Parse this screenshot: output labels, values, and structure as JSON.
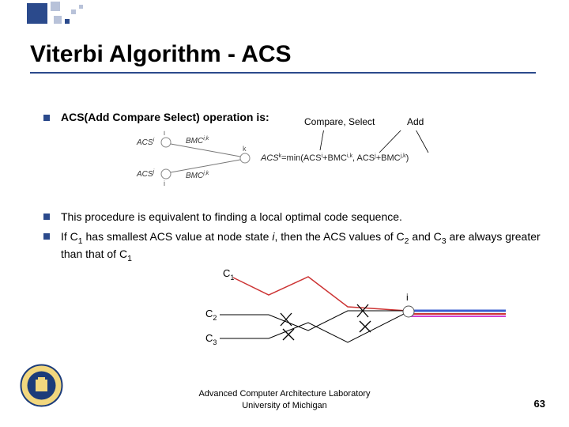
{
  "title": "Viterbi Algorithm - ACS",
  "bullets": {
    "b1": "ACS(Add Compare Select) operation is:",
    "b2": "This procedure is equivalent to finding a local optimal code sequence.",
    "b3_pre": "If C",
    "b3_s1": "1",
    "b3_mid1": " has smallest ACS value at node state ",
    "b3_i": "i",
    "b3_mid2": ", then the ACS values of C",
    "b3_s2": "2",
    "b3_mid3": " and C",
    "b3_s3": "3",
    "b3_mid4": " are always greater than that of C",
    "b3_s4": "1"
  },
  "labels": {
    "compare_select": "Compare, Select",
    "add": "Add"
  },
  "diagram1": {
    "acs_i": "ACS",
    "sup_i": "i",
    "bmc_ik": "BMC",
    "sup_ik": "i,k",
    "acs_j": "ACS",
    "sup_j": "j",
    "bmc_jk": "BMC",
    "sup_jk": "j,k",
    "node_i": "i",
    "node_j": "j",
    "node_k": "k",
    "eq_left": "ACS",
    "eq_sup": "k",
    "eq_eqmin": "=min(ACS",
    "eq_s1": "i",
    "eq_plus1": "+BMC",
    "eq_s2": "i,k",
    "eq_comma": ", ACS",
    "eq_s3": "j",
    "eq_plus2": "+BMC",
    "eq_s4": "j,k",
    "eq_close": ")"
  },
  "diagram2": {
    "c1": "C",
    "c1s": "1",
    "c2": "C",
    "c2s": "2",
    "c3": "C",
    "c3s": "3",
    "i": "i"
  },
  "footer": {
    "line1": "Advanced Computer Architecture Laboratory",
    "line2": "University of Michigan"
  },
  "page_number": "63",
  "colors": {
    "accent": "#2b4a8c",
    "blue_line": "#3b5fd1",
    "red_line": "#cc3333",
    "magenta": "#d040d0"
  }
}
